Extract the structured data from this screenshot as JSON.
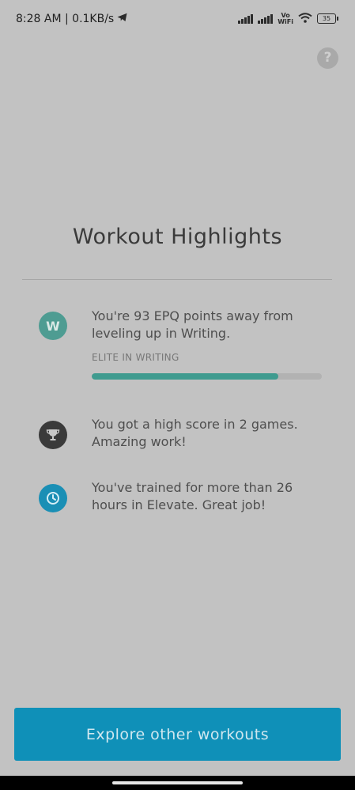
{
  "status_bar": {
    "time": "8:28 AM | 0.1KB/s",
    "vowifi_top": "Vo",
    "vowifi_bottom": "WiFi",
    "battery": "35",
    "icons": [
      "telegram-icon",
      "signal-icon",
      "signal-icon",
      "wifi-icon",
      "battery-icon"
    ]
  },
  "help": {
    "label": "?"
  },
  "title": "Workout Highlights",
  "highlights": [
    {
      "icon_label": "W",
      "icon": "writing-badge-icon",
      "color": "#4e9c92",
      "text": "You're 93 EPQ points away from leveling up in Writing.",
      "progress_label": "ELITE IN WRITING",
      "progress": 0.81
    },
    {
      "icon": "trophy-icon",
      "color": "#3a3a3a",
      "text": "You got a high score in 2 games. Amazing work!"
    },
    {
      "icon": "clock-icon",
      "color": "#1a8fb5",
      "text": "You've trained for more than 26 hours in Elevate. Great job!"
    }
  ],
  "cta": {
    "label": "Explore other workouts",
    "color": "#0f90b8"
  }
}
